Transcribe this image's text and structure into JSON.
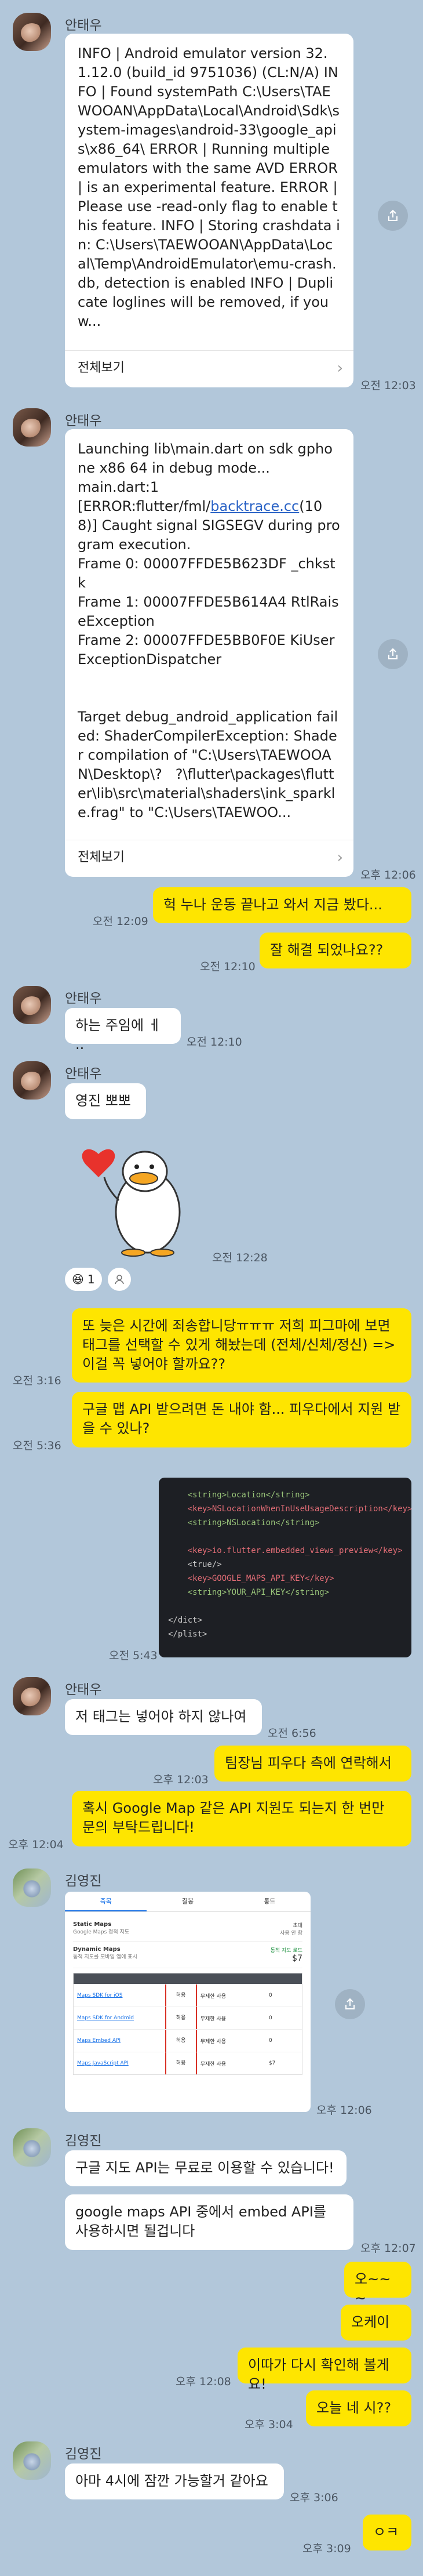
{
  "senders": {
    "a": "안태우",
    "b": "김영진"
  },
  "m1": {
    "text": "INFO | Android emulator version 32.1.12.0 (build_id 9751036) (CL:N/A) INFO | Found systemPath C:\\Users\\TAEWOOAN\\AppData\\Local\\Android\\Sdk\\system-images\\android-33\\google_apis\\x86_64\\ ERROR | Running multiple emulators with the same AVD ERROR | is an experimental feature. ERROR | Please use -read-only flag to enable this feature. INFO | Storing crashdata in: C:\\Users\\TAEWOOAN\\AppData\\Local\\Temp\\AndroidEmulator\\emu-crash.db, detection is enabled INFO | Duplicate loglines will be removed, if you w...",
    "footer": "전체보기",
    "time": "오전 12:03"
  },
  "m2": {
    "text_a": "Launching lib\\main.dart on sdk gphone x86 64 in debug mode...\nmain.dart:1\n[ERROR:flutter/fml/",
    "link": "backtrace.cc",
    "text_b": "(108)] Caught signal SIGSEGV during program execution.\nFrame 0: 00007FFDE5B623DF _chkstk\nFrame 1: 00007FFDE5B614A4 RtlRaiseException\nFrame 2: 00007FFDE5BB0F0E KiUserExceptionDispatcher\n\n\nTarget debug_android_application failed: ShaderCompilerException: Shader compilation of \"C:\\Users\\TAEWOOAN\\Desktop\\?   ?\\flutter\\packages\\flutter\\lib\\src\\material\\shaders\\ink_sparkle.frag\" to \"C:\\Users\\TAEWOO...",
    "footer": "전체보기",
    "time": "오후 12:06"
  },
  "m3": {
    "text": "헉 누나 운동 끝나고 와서 지금 봤다...",
    "time": "오전 12:09"
  },
  "m4": {
    "text": "잘 해결 되었나요??",
    "time": "오전 12:10"
  },
  "m5": {
    "text": "하는 주임에 ㅔ ..",
    "time": "오전 12:10"
  },
  "m6": {
    "text": "영진 뽀뽀",
    "time": "오전 12:28"
  },
  "reaction": {
    "emoji": "😆",
    "count": "1"
  },
  "m7": {
    "text": "또 늦은 시간에 죄송합니당ㅠㅠㅠ 저희 피그마에 보면 태그를 선택할 수 있게 해놨는데 (전체/신체/정신) => 이걸 꼭 넣어야 할까요??",
    "time": "오전 3:16"
  },
  "m8": {
    "text": "구글 맵 API 받으려면 돈 내야 함... 피우다에서 지원 받을 수 있나?",
    "time": "오전 5:36"
  },
  "m9": {
    "lines": [
      "    <string>Location</string>",
      "    <key>NSLocationWhenInUseUsageDescription</key>",
      "    <string>NSLocation</string>",
      "",
      "    <key>io.flutter.embedded_views_preview</key>",
      "    <true/>",
      "    <key>GOOGLE_MAPS_API_KEY</key>",
      "    <string>YOUR_API_KEY</string>",
      "",
      "</dict>",
      "</plist>"
    ],
    "time": "오전 5:43"
  },
  "m10": {
    "text": "저 태그는 넣어야 하지 않나여",
    "time": "오전 6:56"
  },
  "m11": {
    "text": "팀장님 피우다 측에 연락해서",
    "time": "오후 12:03"
  },
  "m12": {
    "text": "혹시 Google Map 같은 API 지원도 되는지 한 번만 문의 부탁드립니다!",
    "time": "오후 12:04"
  },
  "m13": {
    "tabs": [
      "즉목",
      "결봉",
      "통드"
    ],
    "rows": [
      {
        "name": "Static Maps",
        "desc": "Google Maps 정적 지도",
        "v1": "초대",
        "v2": "사용 안 함"
      },
      {
        "name": "Dynamic Maps",
        "desc": "동적 지도를 모바일 앱에 표시",
        "v1": "동적 지도 로드",
        "v2": "$7"
      }
    ],
    "table": [
      {
        "c1": "Maps SDK for iOS",
        "c2": "허용",
        "c3": "무제한 사용",
        "c4": "0"
      },
      {
        "c1": "Maps SDK for Android",
        "c2": "허용",
        "c3": "무제한 사용",
        "c4": "0"
      },
      {
        "c1": "Maps Embed API",
        "c2": "허용",
        "c3": "무제한 사용",
        "c4": "0"
      },
      {
        "c1": "Maps JavaScript API",
        "c2": "허용",
        "c3": "무제한 사용",
        "c4": "$7"
      }
    ],
    "time": "오후 12:06"
  },
  "m14": {
    "text": "구글 지도 API는 무료로 이용할 수 있습니다!"
  },
  "m15": {
    "text": "google maps API 중에서 embed API를 사용하시면 될겁니다",
    "time": "오후 12:07"
  },
  "m16": {
    "text": "오~~~"
  },
  "m17": {
    "text": "오케이"
  },
  "m18": {
    "text": "이따가 다시 확인해 볼게요!",
    "time": "오후 12:08"
  },
  "m19": {
    "text": "오늘 네 시??",
    "time": "오후 3:04"
  },
  "m20": {
    "text": "아마 4시에 잠깐 가능할거 같아요",
    "time": "오후 3:06"
  },
  "m21": {
    "text": "ㅇㅋ",
    "time": "오후 3:09"
  }
}
